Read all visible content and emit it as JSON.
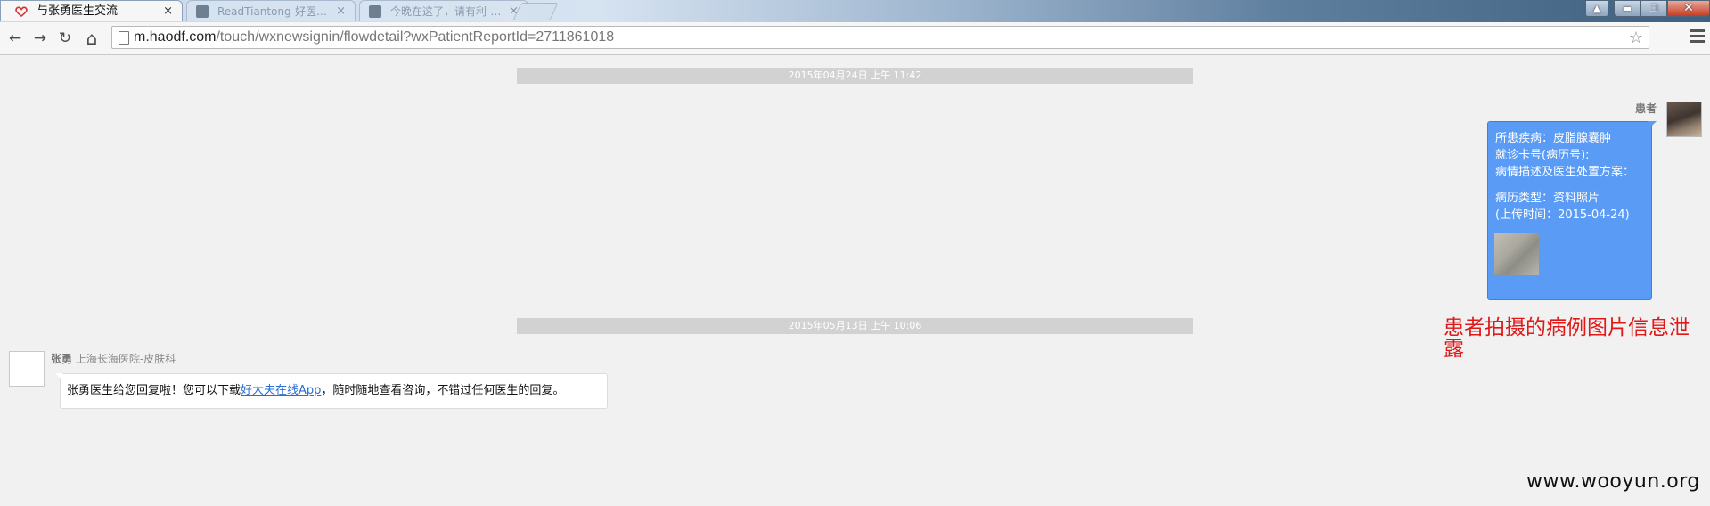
{
  "browser": {
    "tabs": [
      {
        "title": "与张勇医生交流",
        "active": true
      },
      {
        "title": "ReadTiantong-好医…",
        "active": false
      },
      {
        "title": "今晚在这了，请有利-…",
        "active": false
      }
    ],
    "tab_close": "×",
    "window_controls": {
      "minimize": "▬",
      "maximize": "❐",
      "close": "✕"
    },
    "nav": {
      "back": "←",
      "forward": "→",
      "reload": "↻",
      "home": "⌂"
    },
    "url_host": "m.haodf.com",
    "url_path": "/touch/wxnewsignin/flowdetail?wxPatientReportId=2711861018",
    "bookmark_star": "☆"
  },
  "chat": {
    "timestamps": [
      "2015年04月24日 上午 11:42",
      "2015年05月13日 上午 10:06"
    ],
    "patient": {
      "label": "患者",
      "lines": {
        "disease": "所患疾病：皮脂腺囊肿",
        "record_no": "就诊卡号(病历号):",
        "description": "病情描述及医生处置方案：",
        "record_type": "病历类型：资料照片",
        "upload_time": "(上传时间：2015-04-24)"
      }
    },
    "doctor": {
      "name": "张勇",
      "hospital": "上海长海医院-皮肤科",
      "message_before": "张勇医生给您回复啦！您可以下载",
      "message_link": "好大夫在线App",
      "message_after": "，随时随地查看咨询，不错过任何医生的回复。"
    }
  },
  "annotation": "患者拍摄的病例图片信息泄露",
  "watermark": "www.wooyun.org",
  "colors": {
    "bubble_blue": "#5a9bf5",
    "annotation_red": "#e01818",
    "link_blue": "#2a6fd6",
    "timestamp_bar": "#d2d2d2"
  }
}
